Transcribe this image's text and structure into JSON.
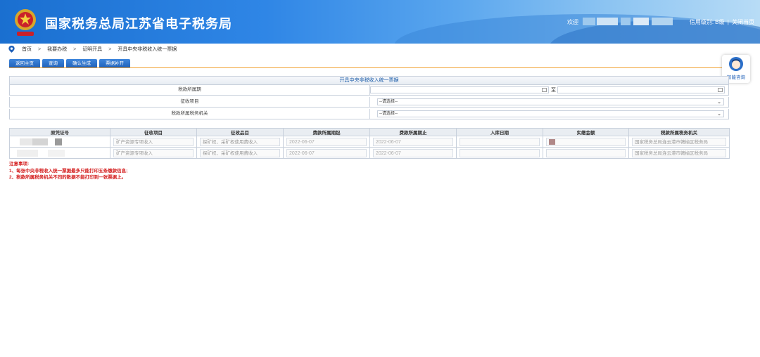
{
  "header": {
    "title": "国家税务总局江苏省电子税务局",
    "welcome": "欢迎",
    "credit_label": "信用级别:",
    "credit_level": "B级",
    "divider": "|",
    "close_label": "关闭当页"
  },
  "breadcrumb": {
    "items": [
      "首页",
      "我要办税",
      "证明开具",
      "开具中央非税收入统一票据"
    ],
    "separator": ">"
  },
  "toolbar": {
    "buttons": [
      "返回主页",
      "查询",
      "确认生成",
      "票据补开"
    ]
  },
  "assistant": {
    "label": "智能咨询"
  },
  "form": {
    "title": "开具中央非税收入统一票据",
    "rows": [
      {
        "label": "税款所属期",
        "separator": "至"
      },
      {
        "label": "征收项目",
        "value": "--请选择--"
      },
      {
        "label": "税款所属税务机关",
        "value": "--请选择--"
      }
    ]
  },
  "table": {
    "headers": [
      "原凭证号",
      "征收项目",
      "征收品目",
      "费款所属期起",
      "费款所属期止",
      "入库日期",
      "实缴金额",
      "税款所属税务机关"
    ],
    "rows": [
      {
        "item": "矿产资源专项收入",
        "subitem": "探矿权、采矿权使用费收入",
        "start": "2022-06-07",
        "end": "2022-06-07",
        "storage_date": "",
        "authority": "国家税务总局连云港市赣榆区税务局"
      },
      {
        "item": "矿产资源专项收入",
        "subitem": "探矿权、采矿权使用费收入",
        "start": "2022-06-07",
        "end": "2022-06-07",
        "storage_date": "",
        "authority": "国家税务总局连云港市赣榆区税务局"
      }
    ]
  },
  "notes": {
    "title": "注意事项:",
    "items": [
      "1、每张中央非税收入统一票据最多只能打印五条缴款信息;",
      "2、税款所属税务机关不同的数据不能打印到一张票据上。"
    ]
  },
  "colors": {
    "header_blue": "#1a6fd0",
    "button_blue": "#1e5fb8",
    "accent_orange": "#f1a233",
    "note_red": "#d42020"
  }
}
